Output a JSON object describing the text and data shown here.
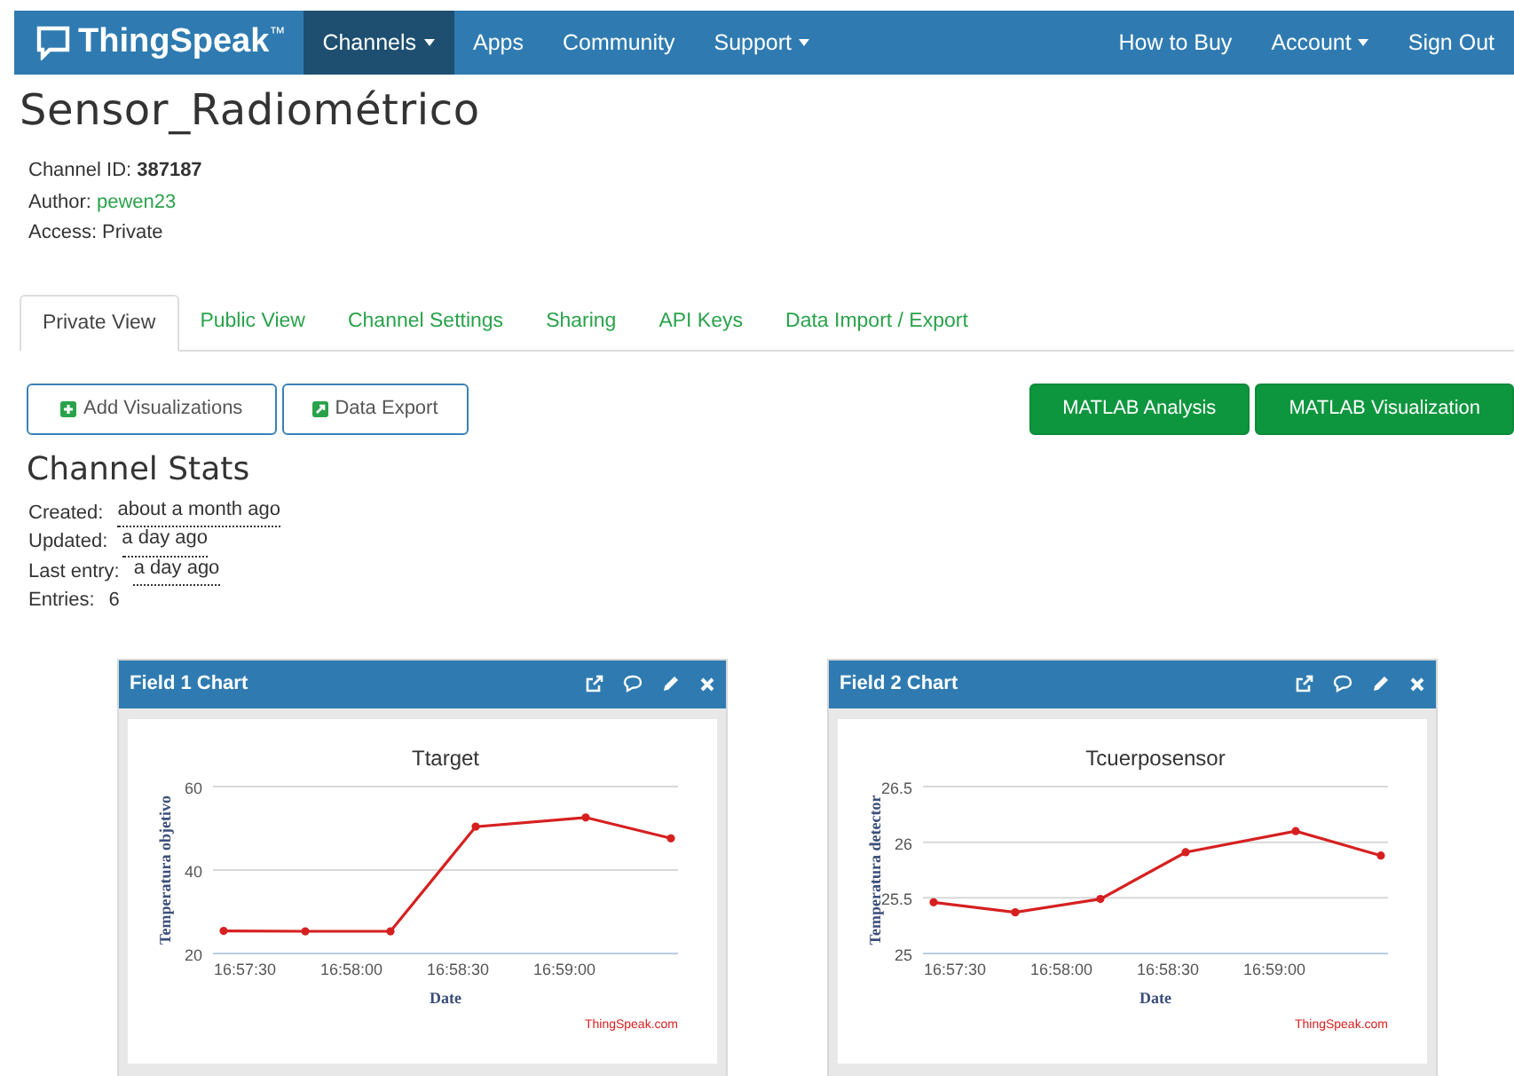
{
  "navbar": {
    "brand": "ThingSpeak",
    "trademark": "™",
    "items": [
      {
        "label": "Channels",
        "selected": true,
        "dropdown": true
      },
      {
        "label": "Apps",
        "selected": false,
        "dropdown": false
      },
      {
        "label": "Community",
        "selected": false,
        "dropdown": false
      },
      {
        "label": "Support",
        "selected": false,
        "dropdown": true
      }
    ],
    "right_items": [
      {
        "label": "How to Buy",
        "dropdown": false
      },
      {
        "label": "Account",
        "dropdown": true
      },
      {
        "label": "Sign Out",
        "dropdown": false
      }
    ]
  },
  "channel": {
    "title": "Sensor_Radiométrico",
    "info": [
      {
        "label": "Channel ID:",
        "value": "387187",
        "kind": "bold"
      },
      {
        "label": "Author:",
        "value": "pewen23",
        "kind": "link"
      },
      {
        "label": "Access:",
        "value": "Private",
        "kind": "plain"
      }
    ]
  },
  "tabs": [
    {
      "label": "Private View",
      "selected": true
    },
    {
      "label": "Public View",
      "selected": false
    },
    {
      "label": "Channel Settings",
      "selected": false
    },
    {
      "label": "Sharing",
      "selected": false
    },
    {
      "label": "API Keys",
      "selected": false
    },
    {
      "label": "Data Import / Export",
      "selected": false
    }
  ],
  "actions": [
    {
      "label": "Add Visualizations",
      "kind": "outline"
    },
    {
      "label": "Data Export",
      "kind": "outline"
    },
    {
      "label": "MATLAB Analysis",
      "kind": "primary"
    },
    {
      "label": "MATLAB Visualization",
      "kind": "primary"
    }
  ],
  "stats": {
    "title": "Channel Stats",
    "rows": [
      {
        "label": "Created:",
        "value": "about a month ago"
      },
      {
        "label": "Updated:",
        "value": "a day ago"
      },
      {
        "label": "Last entry:",
        "value": "a day ago"
      },
      {
        "label": "Entries:",
        "value": "6"
      }
    ]
  },
  "panels": [
    {
      "title": "Field 1 Chart",
      "credit": "ThingSpeak.com",
      "chart_data": {
        "type": "line",
        "title": "Ttarget",
        "xlabel": "Date",
        "ylabel": "Temperatura objetivo",
        "x": [
          61044,
          61067,
          61091,
          61115,
          61146,
          61170
        ],
        "series": [
          {
            "color": "#d62020",
            "marker": "circle",
            "values": [
              25.4,
              25.3,
              25.3,
              50.4,
              52.6,
              47.6
            ]
          }
        ],
        "xlim": [
          61041,
          61172
        ],
        "ylim": [
          20,
          60
        ],
        "xticks": [
          {
            "value": 61050,
            "label": "16:57:30"
          },
          {
            "value": 61080,
            "label": "16:58:00"
          },
          {
            "value": 61110,
            "label": "16:58:30"
          },
          {
            "value": 61140,
            "label": "16:59:00"
          }
        ],
        "yticks": [
          20,
          40,
          60
        ]
      }
    },
    {
      "title": "Field 2 Chart",
      "credit": "ThingSpeak.com",
      "chart_data": {
        "type": "line",
        "title": "Tcuerposensor",
        "xlabel": "Date",
        "ylabel": "Temperatura detector",
        "x": [
          61044,
          61067,
          61091,
          61115,
          61146,
          61170
        ],
        "series": [
          {
            "color": "#d62020",
            "marker": "circle",
            "values": [
              25.46,
              25.37,
              25.49,
              25.91,
              26.1,
              25.88
            ]
          }
        ],
        "xlim": [
          61041,
          61172
        ],
        "ylim": [
          25,
          26.5
        ],
        "xticks": [
          {
            "value": 61050,
            "label": "16:57:30"
          },
          {
            "value": 61080,
            "label": "16:58:00"
          },
          {
            "value": 61110,
            "label": "16:58:30"
          },
          {
            "value": 61140,
            "label": "16:59:00"
          }
        ],
        "yticks": [
          {
            "value": 25,
            "label": "25"
          },
          {
            "value": 25.5,
            "label": "25.5"
          },
          {
            "value": 26,
            "label": "26"
          },
          {
            "value": 26.5,
            "label": "26.5"
          }
        ]
      }
    }
  ]
}
